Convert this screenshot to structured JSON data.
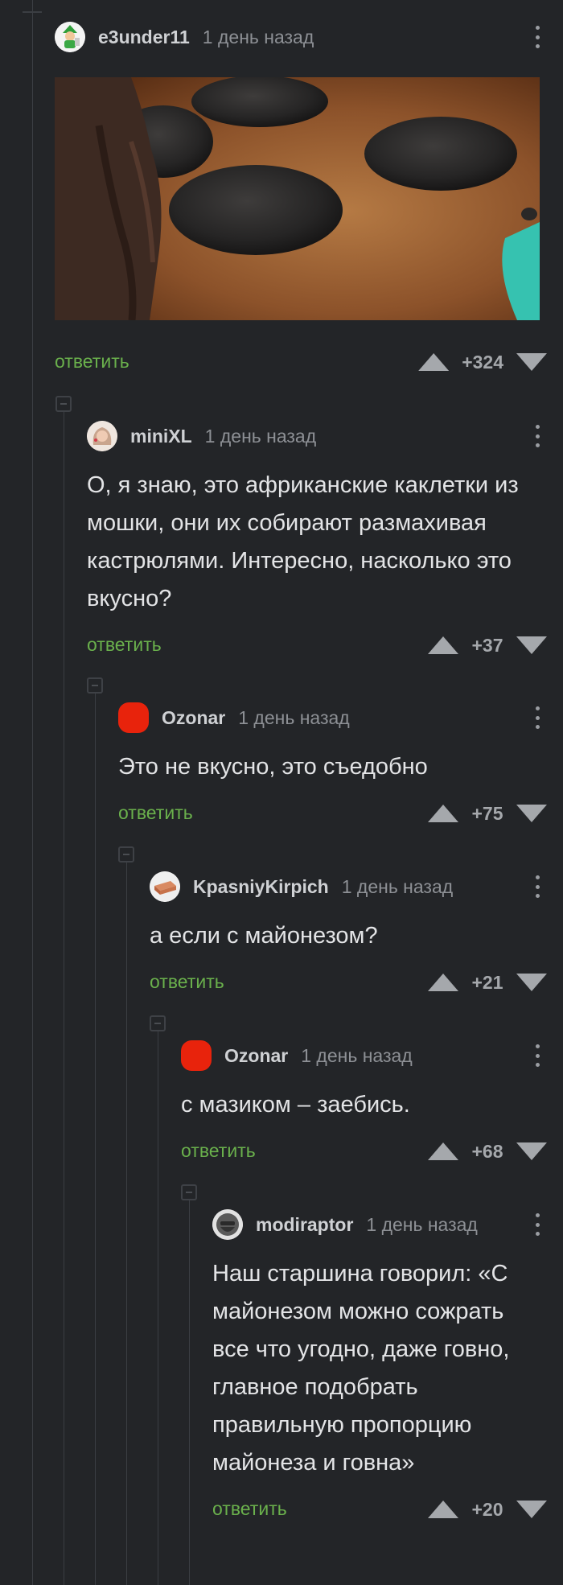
{
  "post": {
    "author": "e3under11",
    "time": "1 день назад",
    "reply_label": "ответить",
    "score": "+324"
  },
  "comments": [
    {
      "author": "miniXL",
      "time": "1 день назад",
      "text": "О, я знаю, это африканские каклетки из мошки, они их собирают размахивая кастрюлями. Интересно, насколько это вкусно?",
      "reply_label": "ответить",
      "score": "+37"
    },
    {
      "author": "Ozonar",
      "time": "1 день назад",
      "text": "Это не вкусно, это съедобно",
      "reply_label": "ответить",
      "score": "+75"
    },
    {
      "author": "KpasniyKirpich",
      "time": "1 день назад",
      "text": "а если с майонезом?",
      "reply_label": "ответить",
      "score": "+21"
    },
    {
      "author": "Ozonar",
      "time": "1 день назад",
      "text": "с мазиком – заебись.",
      "reply_label": "ответить",
      "score": "+68"
    },
    {
      "author": "modiraptor",
      "time": "1 день назад",
      "text": "Наш старшина говорил: «С майонезом можно сожрать все что угодно, даже говно, главное подобрать правильную пропорцию майонеза и говна»",
      "reply_label": "ответить",
      "score": "+20"
    }
  ],
  "icons": {
    "upvote": "triangle-up",
    "downvote": "triangle-down",
    "menu": "vertical-ellipsis",
    "collapse": "collapse-square"
  },
  "colors": {
    "background": "#232528",
    "reply_link": "#6ab04c",
    "vote": "#a5a8ac",
    "ozonar_avatar": "#e8230c"
  }
}
